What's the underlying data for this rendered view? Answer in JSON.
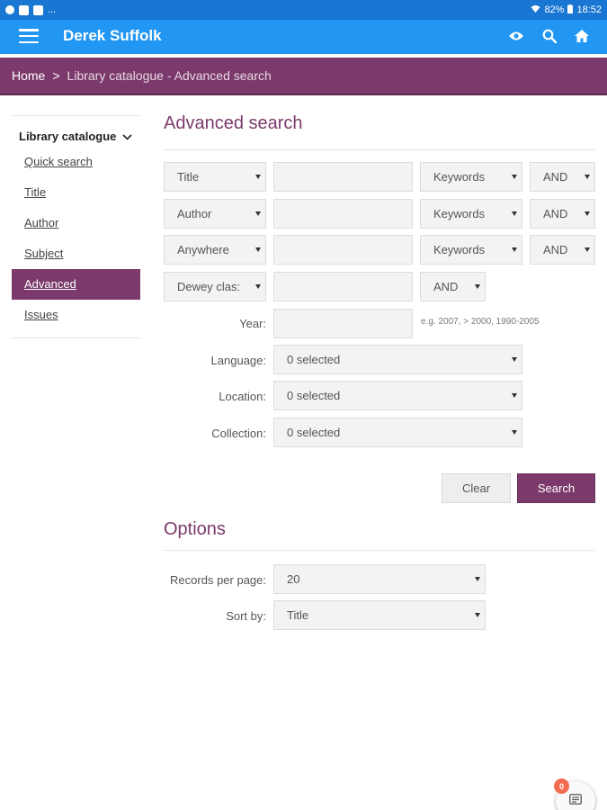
{
  "statusbar": {
    "left_more": "...",
    "battery": "82%",
    "time": "18:52"
  },
  "appbar": {
    "title": "Derek Suffolk",
    "icons": [
      "hamburger-menu-icon",
      "eye-icon",
      "search-icon",
      "home-icon"
    ]
  },
  "breadcrumb": {
    "home": "Home",
    "separator": ">",
    "current": "Library catalogue - Advanced search"
  },
  "sidebar": {
    "heading": "Library catalogue",
    "items": [
      {
        "label": "Quick search",
        "active": false
      },
      {
        "label": "Title",
        "active": false
      },
      {
        "label": "Author",
        "active": false
      },
      {
        "label": "Subject",
        "active": false
      },
      {
        "label": "Advanced",
        "active": true
      },
      {
        "label": "Issues",
        "active": false
      }
    ]
  },
  "search": {
    "heading": "Advanced search",
    "rows": [
      {
        "field": "Title",
        "match": "Keywords",
        "operator": "AND",
        "value": ""
      },
      {
        "field": "Author",
        "match": "Keywords",
        "operator": "AND",
        "value": ""
      },
      {
        "field": "Anywhere",
        "match": "Keywords",
        "operator": "AND",
        "value": ""
      },
      {
        "field": "Dewey clas:",
        "operator": "AND",
        "value": ""
      }
    ],
    "year_label": "Year:",
    "year_value": "",
    "year_hint": "e.g. 2007, > 2000, 1990-2005",
    "language_label": "Language:",
    "language_value": "0 selected",
    "location_label": "Location:",
    "location_value": "0 selected",
    "collection_label": "Collection:",
    "collection_value": "0 selected",
    "clear_label": "Clear",
    "search_label": "Search"
  },
  "options": {
    "heading": "Options",
    "records_label": "Records per page:",
    "records_value": "20",
    "sort_label": "Sort by:",
    "sort_value": "Title"
  },
  "fab": {
    "badge": "0",
    "icon": "basket-list-icon"
  },
  "colors": {
    "appbar": "#2196f3",
    "statusbar": "#1976d2",
    "brand": "#7b3a6b",
    "badge": "#f26b4f"
  }
}
